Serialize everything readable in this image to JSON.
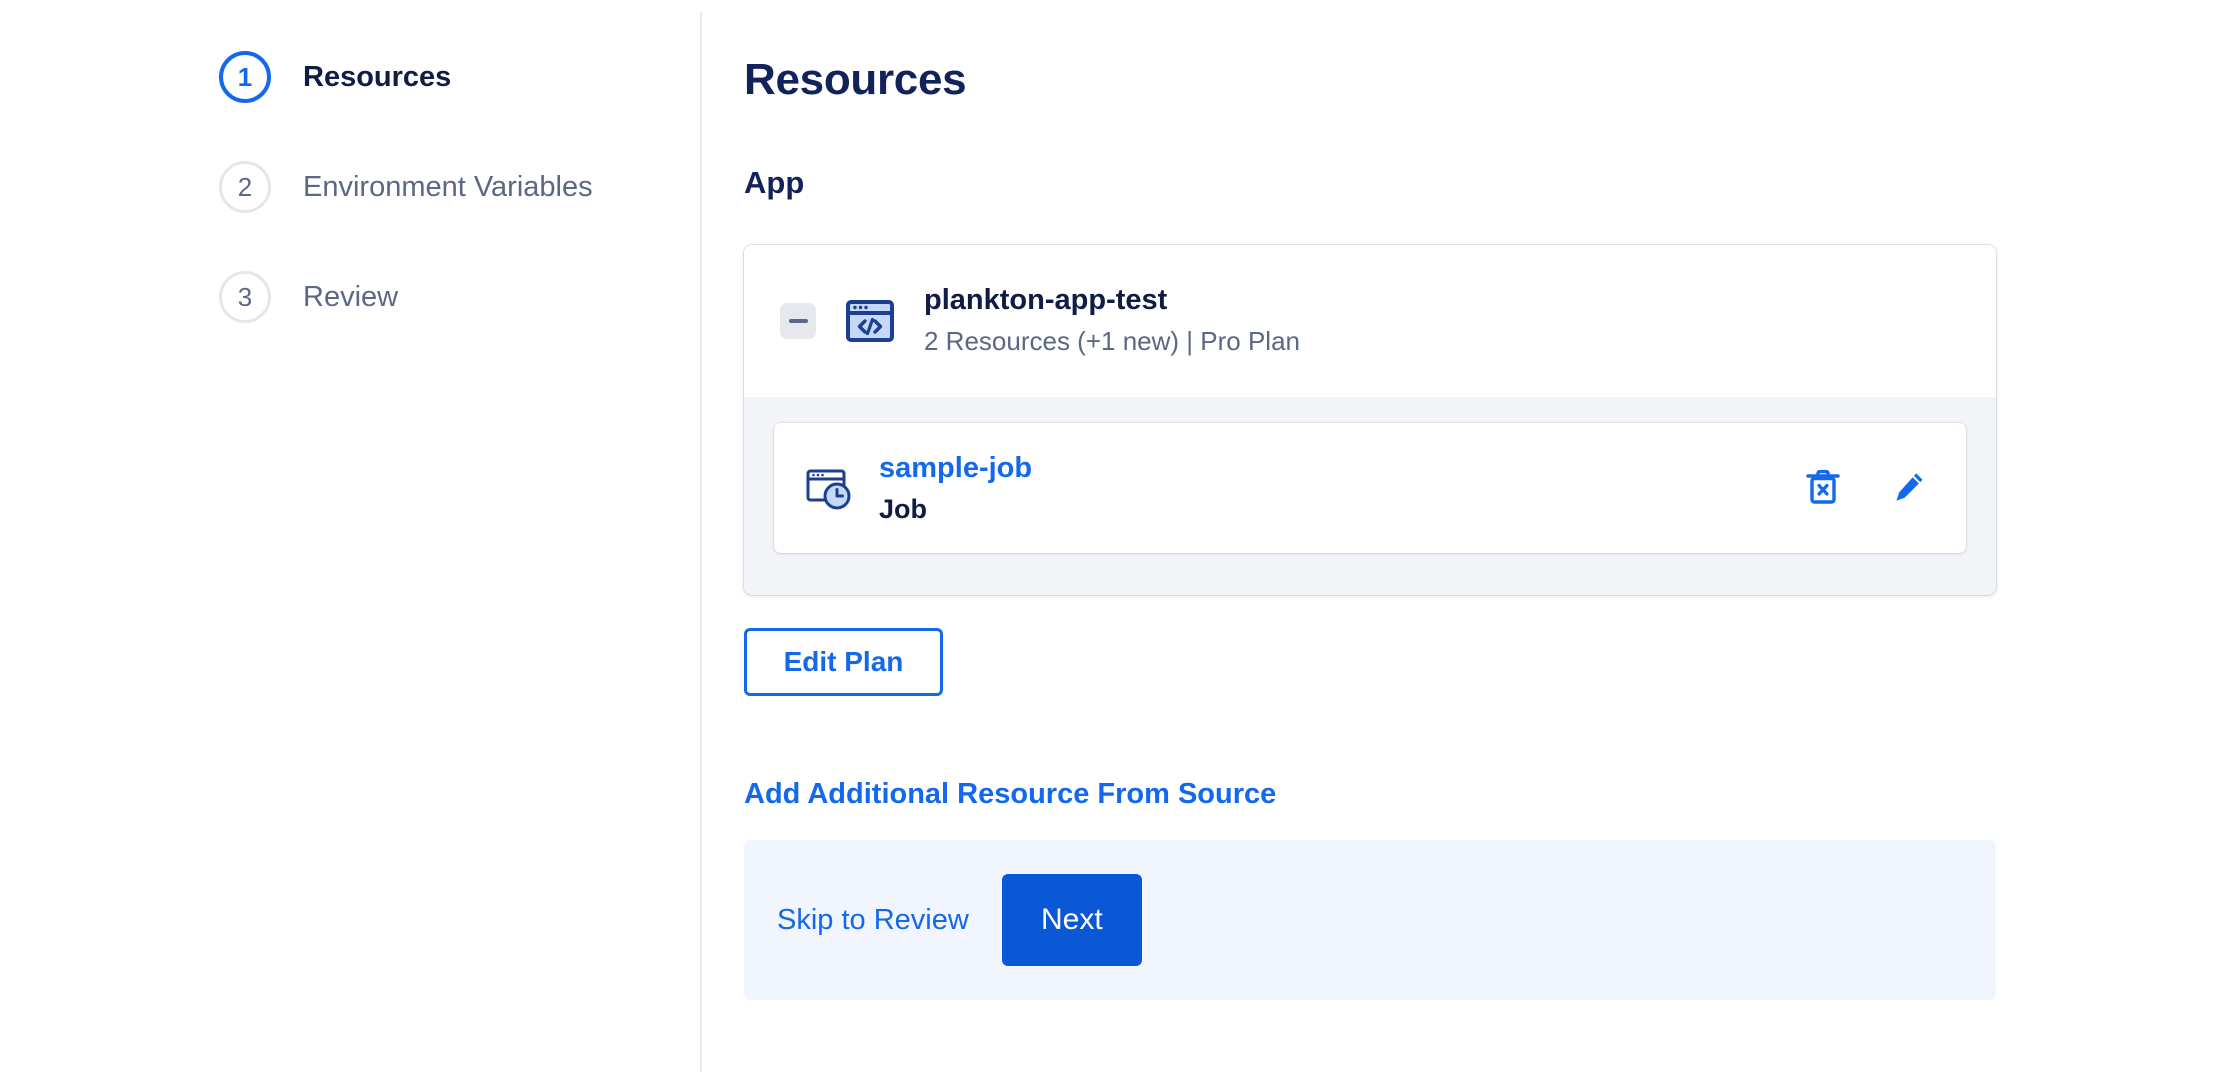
{
  "stepper": {
    "steps": [
      {
        "number": "1",
        "label": "Resources",
        "state": "active"
      },
      {
        "number": "2",
        "label": "Environment Variables",
        "state": "inactive"
      },
      {
        "number": "3",
        "label": "Review",
        "state": "inactive"
      }
    ]
  },
  "main": {
    "page_title": "Resources",
    "section_title": "App",
    "app_card": {
      "collapse_icon": "minus-icon",
      "app_icon": "code-window-icon",
      "name": "plankton-app-test",
      "subtitle": "2 Resources (+1 new) | Pro Plan",
      "resources": [
        {
          "icon": "job-clock-window-icon",
          "name": "sample-job",
          "type": "Job",
          "delete_icon": "trash-x-icon",
          "edit_icon": "pencil-icon"
        }
      ]
    },
    "edit_plan_label": "Edit Plan",
    "add_resource_label": "Add Additional Resource From Source",
    "footer": {
      "skip_label": "Skip to Review",
      "next_label": "Next"
    }
  },
  "colors": {
    "accent_blue": "#1368ec",
    "next_button_blue": "#0a58d6",
    "heading_navy": "#11235a",
    "muted_text": "#5c6784",
    "card_body_bg": "#f2f4f8",
    "action_bar_bg": "#f1f5fe",
    "divider": "#e7e9ee"
  }
}
